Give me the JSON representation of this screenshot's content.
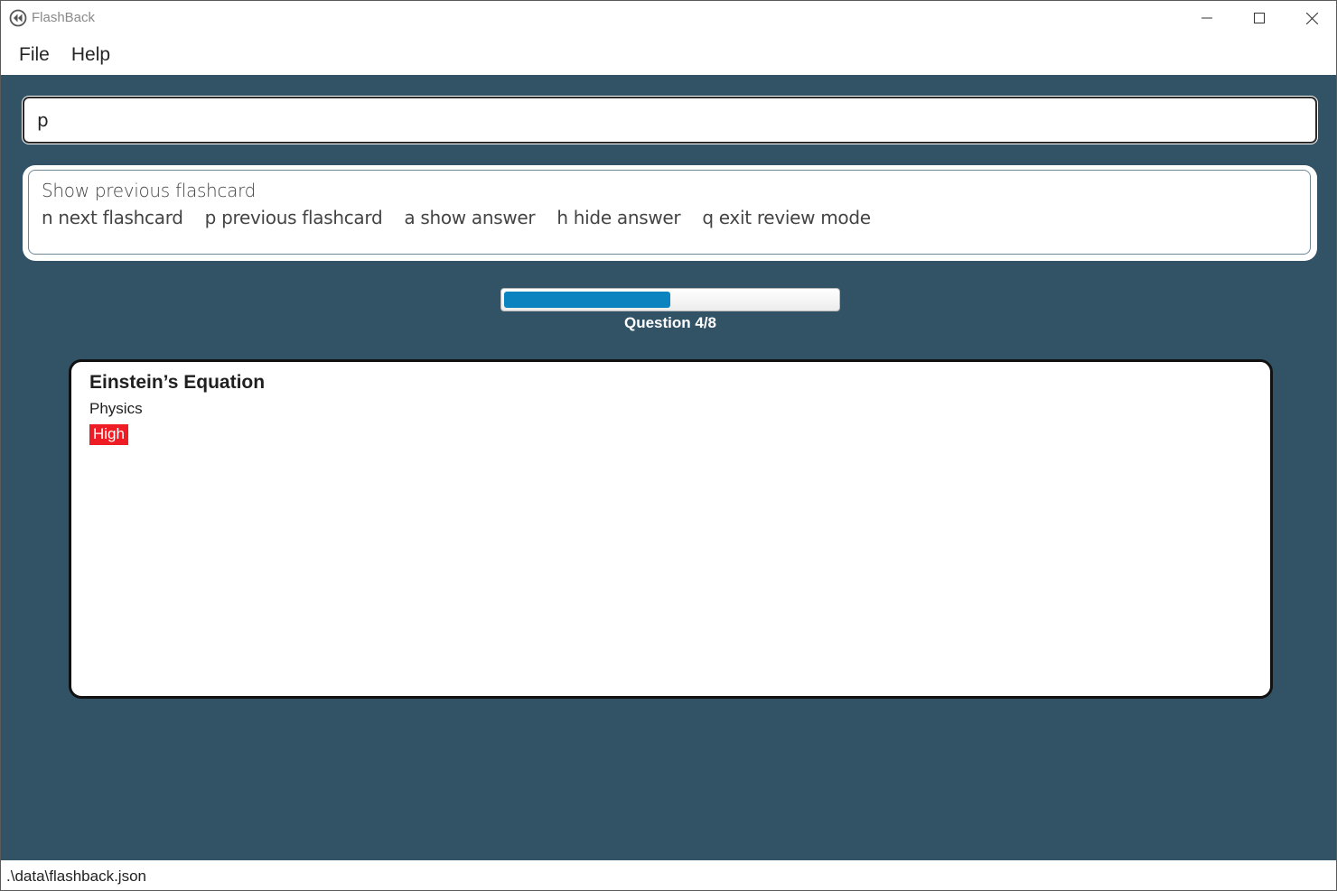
{
  "window": {
    "title": "FlashBack",
    "controls": {
      "minimize": "minimize",
      "maximize": "maximize",
      "close": "close"
    }
  },
  "menu": {
    "file": "File",
    "help": "Help"
  },
  "command_box": {
    "value": "p"
  },
  "result": {
    "title": "Show previous flashcard",
    "commands": [
      "n next flashcard",
      "p previous flashcard",
      "a show answer",
      "h hide answer",
      "q exit review mode"
    ]
  },
  "progress": {
    "label": "Question 4/8",
    "current": 4,
    "total": 8
  },
  "flashcard": {
    "title": "Einstein’s Equation",
    "category": "Physics",
    "priority": "High",
    "priority_color": "#ee1c25"
  },
  "statusbar": {
    "path": ".\\data\\flashback.json"
  },
  "colors": {
    "background": "#325366",
    "progress_fill": "#0a83be"
  }
}
